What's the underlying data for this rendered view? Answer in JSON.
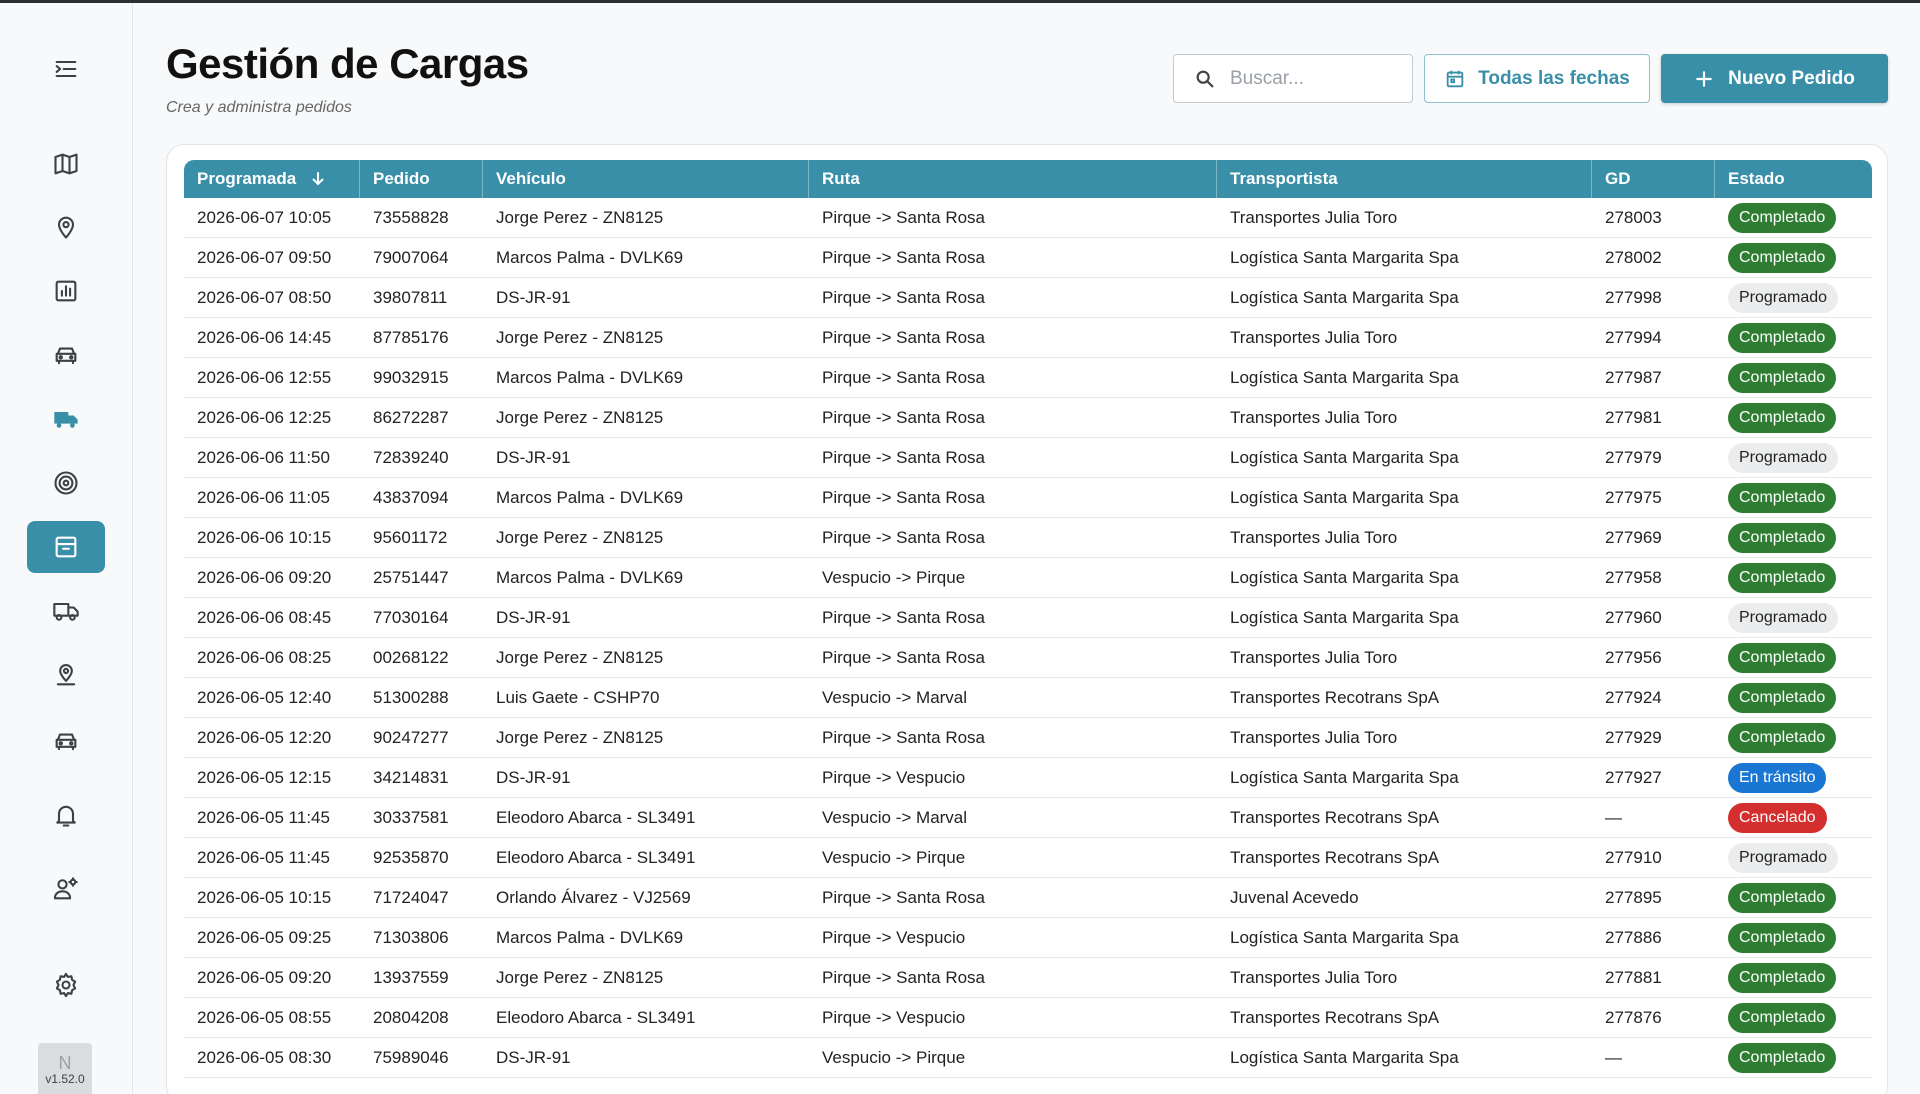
{
  "header": {
    "title": "Gestión de Cargas",
    "subtitle": "Crea y administra pedidos"
  },
  "toolbar": {
    "search_placeholder": "Buscar...",
    "dates_label": "Todas las fechas",
    "new_label": "Nuevo Pedido"
  },
  "sidebar": {
    "items": [
      {
        "name": "menu-collapse-icon"
      },
      {
        "name": "map-icon"
      },
      {
        "name": "location-pin-icon"
      },
      {
        "name": "bar-chart-icon"
      },
      {
        "name": "car-icon"
      },
      {
        "name": "truck-icon"
      },
      {
        "name": "target-icon"
      },
      {
        "name": "archive-icon",
        "active": true
      },
      {
        "name": "delivery-truck-icon"
      },
      {
        "name": "map-marker-icon"
      },
      {
        "name": "car-front-icon"
      },
      {
        "name": "bell-icon"
      },
      {
        "name": "users-gear-icon"
      },
      {
        "name": "settings-icon"
      }
    ],
    "avatar_initial": "N",
    "version": "v1.52.0"
  },
  "colors": {
    "accent": "#3a8fa8",
    "completado": "#2e7d32",
    "programado": "#ebeced",
    "en_transito": "#1976d2",
    "cancelado": "#d32f2f"
  },
  "table": {
    "columns": [
      "Programada",
      "Pedido",
      "Vehículo",
      "Ruta",
      "Transportista",
      "GD",
      "Estado"
    ],
    "rows": [
      {
        "programada": "2026-06-07 10:05",
        "pedido": "73558828",
        "vehiculo": "Jorge Perez - ZN8125",
        "ruta": "Pirque -> Santa Rosa",
        "transportista": "Transportes Julia Toro",
        "gd": "278003",
        "estado": "Completado"
      },
      {
        "programada": "2026-06-07 09:50",
        "pedido": "79007064",
        "vehiculo": "Marcos Palma - DVLK69",
        "ruta": "Pirque -> Santa Rosa",
        "transportista": "Logística Santa Margarita Spa",
        "gd": "278002",
        "estado": "Completado"
      },
      {
        "programada": "2026-06-07 08:50",
        "pedido": "39807811",
        "vehiculo": "DS-JR-91",
        "ruta": "Pirque -> Santa Rosa",
        "transportista": "Logística Santa Margarita Spa",
        "gd": "277998",
        "estado": "Programado"
      },
      {
        "programada": "2026-06-06 14:45",
        "pedido": "87785176",
        "vehiculo": "Jorge Perez - ZN8125",
        "ruta": "Pirque -> Santa Rosa",
        "transportista": "Transportes Julia Toro",
        "gd": "277994",
        "estado": "Completado"
      },
      {
        "programada": "2026-06-06 12:55",
        "pedido": "99032915",
        "vehiculo": "Marcos Palma - DVLK69",
        "ruta": "Pirque -> Santa Rosa",
        "transportista": "Logística Santa Margarita Spa",
        "gd": "277987",
        "estado": "Completado"
      },
      {
        "programada": "2026-06-06 12:25",
        "pedido": "86272287",
        "vehiculo": "Jorge Perez - ZN8125",
        "ruta": "Pirque -> Santa Rosa",
        "transportista": "Transportes Julia Toro",
        "gd": "277981",
        "estado": "Completado"
      },
      {
        "programada": "2026-06-06 11:50",
        "pedido": "72839240",
        "vehiculo": "DS-JR-91",
        "ruta": "Pirque -> Santa Rosa",
        "transportista": "Logística Santa Margarita Spa",
        "gd": "277979",
        "estado": "Programado"
      },
      {
        "programada": "2026-06-06 11:05",
        "pedido": "43837094",
        "vehiculo": "Marcos Palma - DVLK69",
        "ruta": "Pirque -> Santa Rosa",
        "transportista": "Logística Santa Margarita Spa",
        "gd": "277975",
        "estado": "Completado"
      },
      {
        "programada": "2026-06-06 10:15",
        "pedido": "95601172",
        "vehiculo": "Jorge Perez - ZN8125",
        "ruta": "Pirque -> Santa Rosa",
        "transportista": "Transportes Julia Toro",
        "gd": "277969",
        "estado": "Completado"
      },
      {
        "programada": "2026-06-06 09:20",
        "pedido": "25751447",
        "vehiculo": "Marcos Palma - DVLK69",
        "ruta": "Vespucio -> Pirque",
        "transportista": "Logística Santa Margarita Spa",
        "gd": "277958",
        "estado": "Completado"
      },
      {
        "programada": "2026-06-06 08:45",
        "pedido": "77030164",
        "vehiculo": "DS-JR-91",
        "ruta": "Pirque -> Santa Rosa",
        "transportista": "Logística Santa Margarita Spa",
        "gd": "277960",
        "estado": "Programado"
      },
      {
        "programada": "2026-06-06 08:25",
        "pedido": "00268122",
        "vehiculo": "Jorge Perez - ZN8125",
        "ruta": "Pirque -> Santa Rosa",
        "transportista": "Transportes Julia Toro",
        "gd": "277956",
        "estado": "Completado"
      },
      {
        "programada": "2026-06-05 12:40",
        "pedido": "51300288",
        "vehiculo": "Luis Gaete - CSHP70",
        "ruta": "Vespucio -> Marval",
        "transportista": "Transportes Recotrans SpA",
        "gd": "277924",
        "estado": "Completado"
      },
      {
        "programada": "2026-06-05 12:20",
        "pedido": "90247277",
        "vehiculo": "Jorge Perez - ZN8125",
        "ruta": "Pirque -> Santa Rosa",
        "transportista": "Transportes Julia Toro",
        "gd": "277929",
        "estado": "Completado"
      },
      {
        "programada": "2026-06-05 12:15",
        "pedido": "34214831",
        "vehiculo": "DS-JR-91",
        "ruta": "Pirque -> Vespucio",
        "transportista": "Logística Santa Margarita Spa",
        "gd": "277927",
        "estado": "En tránsito"
      },
      {
        "programada": "2026-06-05 11:45",
        "pedido": "30337581",
        "vehiculo": "Eleodoro Abarca - SL3491",
        "ruta": "Vespucio -> Marval",
        "transportista": "Transportes Recotrans SpA",
        "gd": "—",
        "estado": "Cancelado"
      },
      {
        "programada": "2026-06-05 11:45",
        "pedido": "92535870",
        "vehiculo": "Eleodoro Abarca - SL3491",
        "ruta": "Vespucio -> Pirque",
        "transportista": "Transportes Recotrans SpA",
        "gd": "277910",
        "estado": "Programado"
      },
      {
        "programada": "2026-06-05 10:15",
        "pedido": "71724047",
        "vehiculo": "Orlando Álvarez - VJ2569",
        "ruta": "Pirque -> Santa Rosa",
        "transportista": "Juvenal Acevedo",
        "gd": "277895",
        "estado": "Completado"
      },
      {
        "programada": "2026-06-05 09:25",
        "pedido": "71303806",
        "vehiculo": "Marcos Palma - DVLK69",
        "ruta": "Pirque -> Vespucio",
        "transportista": "Logística Santa Margarita Spa",
        "gd": "277886",
        "estado": "Completado"
      },
      {
        "programada": "2026-06-05 09:20",
        "pedido": "13937559",
        "vehiculo": "Jorge Perez - ZN8125",
        "ruta": "Pirque -> Santa Rosa",
        "transportista": "Transportes Julia Toro",
        "gd": "277881",
        "estado": "Completado"
      },
      {
        "programada": "2026-06-05 08:55",
        "pedido": "20804208",
        "vehiculo": "Eleodoro Abarca - SL3491",
        "ruta": "Pirque -> Vespucio",
        "transportista": "Transportes Recotrans SpA",
        "gd": "277876",
        "estado": "Completado"
      },
      {
        "programada": "2026-06-05 08:30",
        "pedido": "75989046",
        "vehiculo": "DS-JR-91",
        "ruta": "Vespucio -> Pirque",
        "transportista": "Logística Santa Margarita Spa",
        "gd": "—",
        "estado": "Completado"
      }
    ]
  }
}
